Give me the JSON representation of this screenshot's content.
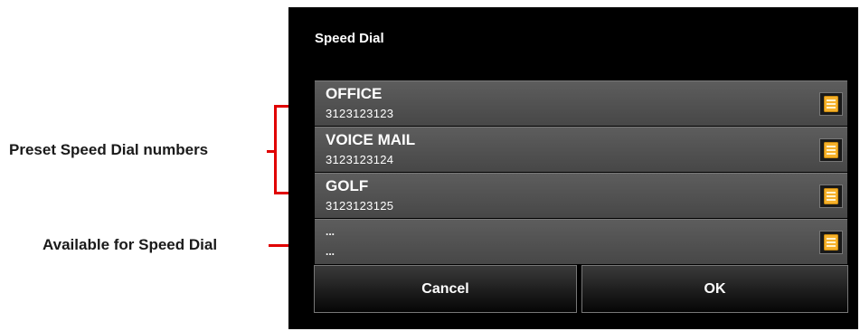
{
  "annotations": {
    "preset": "Preset Speed Dial numbers",
    "available": "Available for Speed Dial",
    "line_color": "#e00000"
  },
  "dialog": {
    "title": "Speed Dial",
    "entries": [
      {
        "name": "OFFICE",
        "number": "3123123123",
        "icon": "edit-note-icon"
      },
      {
        "name": "VOICE MAIL",
        "number": "3123123124",
        "icon": "edit-note-icon"
      },
      {
        "name": "GOLF",
        "number": "3123123125",
        "icon": "edit-note-icon"
      },
      {
        "name": "...",
        "number": "...",
        "icon": "edit-note-icon"
      }
    ],
    "buttons": {
      "cancel": "Cancel",
      "ok": "OK"
    }
  }
}
